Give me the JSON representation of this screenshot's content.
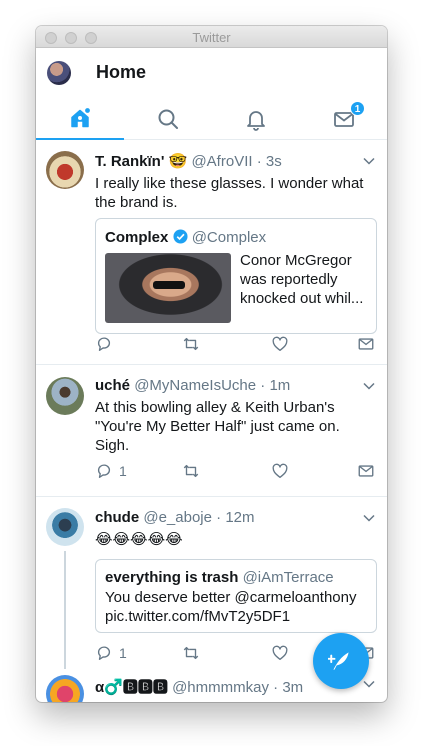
{
  "window": {
    "title": "Twitter"
  },
  "header": {
    "title": "Home"
  },
  "tabs": {
    "dm_badge": "1"
  },
  "tweets": [
    {
      "name": "T. Rankïn'",
      "emoji": "🤓",
      "handle": "@AfroVII",
      "time": "3s",
      "text": "I really like these glasses. I wonder what the brand is.",
      "quote": {
        "name": "Complex",
        "handle": "@Complex",
        "text": "Conor McGregor was reportedly knocked out whil..."
      }
    },
    {
      "name": "uché",
      "handle": "@MyNameIsUche",
      "time": "1m",
      "text": "At this bowling alley & Keith Urban's \"You're My Better Half\" just came on. Sigh.",
      "reply_count": "1"
    },
    {
      "name": "chude",
      "handle": "@e_aboje",
      "time": "12m",
      "text": "😂😂😂😂😂",
      "reply_count": "1",
      "quote": {
        "name": "everything is trash",
        "handle": "@iAmTerrace",
        "text": "You deserve better @carmeloanthony pic.twitter.com/fMvT2y5DF1"
      }
    },
    {
      "name": "α♂️🅱🅱🅱",
      "handle": "@hmmmmkay",
      "time": "3m"
    }
  ],
  "separator": "·",
  "colors": {
    "accent": "#1da1f2",
    "muted": "#657786",
    "border": "#e6ecf0"
  }
}
